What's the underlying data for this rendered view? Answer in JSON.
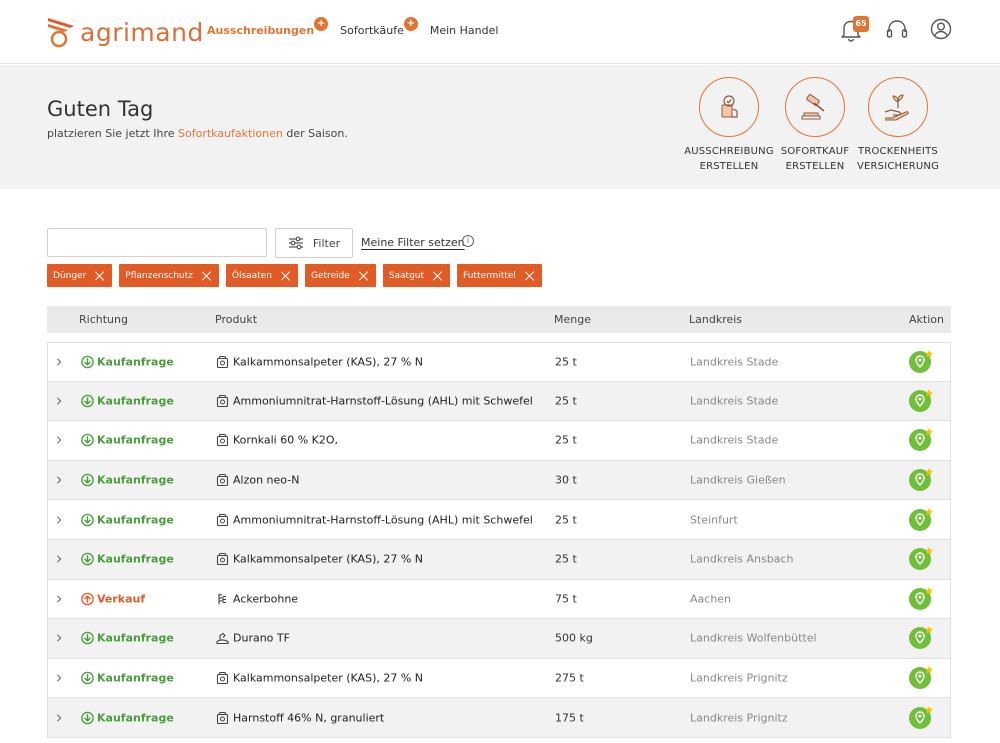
{
  "brand": {
    "name": "agrimand"
  },
  "nav": [
    {
      "label": "Ausschreibungen",
      "active": true,
      "plus": true
    },
    {
      "label": "Sofortkäufe",
      "active": false,
      "plus": true
    },
    {
      "label": "Mein Handel",
      "active": false,
      "plus": false
    }
  ],
  "nav_plus_symbol": "+",
  "notifications": {
    "count": "65"
  },
  "hero": {
    "greeting": "Guten Tag",
    "sub_before": "platzieren Sie jetzt Ihre ",
    "sub_link": "Sofortkaufaktionen",
    "sub_after": " der Saison."
  },
  "actions": [
    {
      "line1": "AUSSCHREIBUNG",
      "line2": "ERSTELLEN",
      "icon": "tender-icon"
    },
    {
      "line1": "SOFORTKAUF",
      "line2": "ERSTELLEN",
      "icon": "gavel-icon"
    },
    {
      "line1": "TROCKENHEITS",
      "line2": "VERSICHERUNG",
      "icon": "hand-plant-icon"
    }
  ],
  "filters": {
    "search_placeholder": "",
    "filter_label": "Filter",
    "my_filter_label": "Meine Filter setzen",
    "info_symbol": "i",
    "chips": [
      "Dünger",
      "Pflanzenschutz",
      "Ölsaaten",
      "Getreide",
      "Saatgut",
      "Futtermittel"
    ]
  },
  "table": {
    "headers": {
      "direction": "Richtung",
      "product": "Produkt",
      "quantity": "Menge",
      "district": "Landkreis",
      "action": "Aktion"
    },
    "rows": [
      {
        "direction": "Kaufanfrage",
        "type": "buy",
        "product": "Kalkammonsalpeter (KAS), 27 % N",
        "product_icon": "fertilizer-bag-icon",
        "quantity": "25 t",
        "district": "Landkreis Stade"
      },
      {
        "direction": "Kaufanfrage",
        "type": "buy",
        "product": "Ammoniumnitrat-Harnstoff-Lösung (AHL) mit Schwefel",
        "product_icon": "fertilizer-bag-icon",
        "quantity": "25 t",
        "district": "Landkreis Stade"
      },
      {
        "direction": "Kaufanfrage",
        "type": "buy",
        "product": "Kornkali 60 % K2O,",
        "product_icon": "fertilizer-bag-icon",
        "quantity": "25 t",
        "district": "Landkreis Stade"
      },
      {
        "direction": "Kaufanfrage",
        "type": "buy",
        "product": "Alzon neo-N",
        "product_icon": "fertilizer-bag-icon",
        "quantity": "30 t",
        "district": "Landkreis Gießen"
      },
      {
        "direction": "Kaufanfrage",
        "type": "buy",
        "product": "Ammoniumnitrat-Harnstoff-Lösung (AHL) mit Schwefel",
        "product_icon": "fertilizer-bag-icon",
        "quantity": "25 t",
        "district": "Steinfurt"
      },
      {
        "direction": "Kaufanfrage",
        "type": "buy",
        "product": "Kalkammonsalpeter (KAS), 27 % N",
        "product_icon": "fertilizer-bag-icon",
        "quantity": "25 t",
        "district": "Landkreis Ansbach"
      },
      {
        "direction": "Verkauf",
        "type": "sell",
        "product": "Ackerbohne",
        "product_icon": "grain-icon",
        "quantity": "75 t",
        "district": "Aachen"
      },
      {
        "direction": "Kaufanfrage",
        "type": "buy",
        "product": "Durano TF",
        "product_icon": "crop-protection-icon",
        "quantity": "500 kg",
        "district": "Landkreis Wolfenbüttel"
      },
      {
        "direction": "Kaufanfrage",
        "type": "buy",
        "product": "Kalkammonsalpeter (KAS), 27 % N",
        "product_icon": "fertilizer-bag-icon",
        "quantity": "275 t",
        "district": "Landkreis Prignitz"
      },
      {
        "direction": "Kaufanfrage",
        "type": "buy",
        "product": "Harnstoff 46% N, granuliert",
        "product_icon": "fertilizer-bag-icon",
        "quantity": "175 t",
        "district": "Landkreis Prignitz"
      }
    ]
  },
  "colors": {
    "accent": "#e07533",
    "chip": "#e05b26",
    "buy": "#4a9d3c",
    "sell": "#e05b26",
    "action_green": "#6fbf3b",
    "star": "#f5c400"
  }
}
